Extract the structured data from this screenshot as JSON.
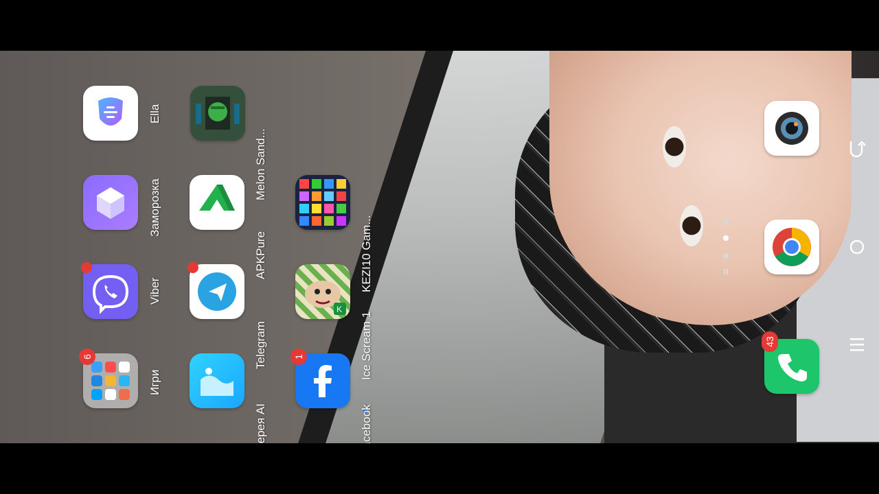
{
  "apps": {
    "ella": {
      "label": "Ella"
    },
    "melon": {
      "label": "Melon Sand..."
    },
    "zamorozka": {
      "label": "Заморозка"
    },
    "apkpure": {
      "label": "APKPure"
    },
    "kezi": {
      "label": "KEZI10 Gam..."
    },
    "viber": {
      "label": "Viber"
    },
    "telegram": {
      "label": "Telegram"
    },
    "icescream": {
      "label": "Ice Scream 1"
    },
    "igri": {
      "label": "Игри",
      "badge": "6"
    },
    "gallery": {
      "label": "Галерея AI"
    },
    "facebook": {
      "label": "Facebook",
      "badge": "1"
    }
  },
  "dock": {
    "phone_badge": "43"
  },
  "colors": {
    "badge": "#e53935",
    "phone": "#1ec66b",
    "facebook": "#1877f2",
    "telegram": "#2aa3e3",
    "viber": "#7360f2"
  }
}
